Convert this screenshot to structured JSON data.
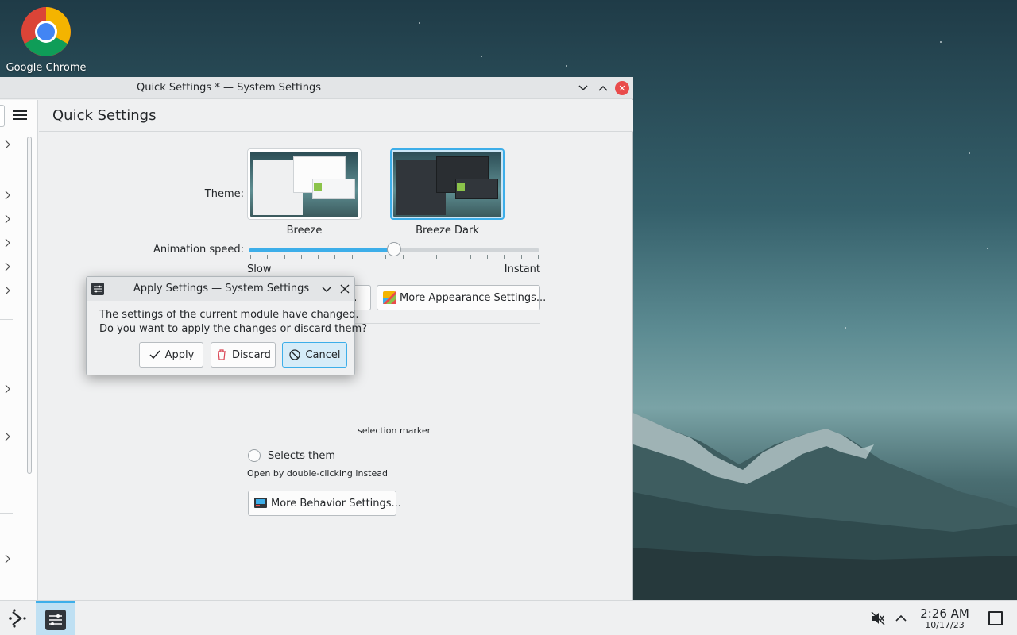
{
  "desktop": {
    "icons": [
      {
        "label": "Google Chrome"
      }
    ]
  },
  "window": {
    "title": "Quick Settings * — System Settings",
    "page_title": "Quick Settings"
  },
  "theme": {
    "label": "Theme:",
    "options": [
      {
        "name": "Breeze",
        "selected": false
      },
      {
        "name": "Breeze Dark",
        "selected": true
      }
    ]
  },
  "animation": {
    "label": "Animation speed:",
    "min_label": "Slow",
    "max_label": "Instant",
    "value_fraction": 0.5
  },
  "buttons": {
    "more_appearance": "More Appearance Settings...",
    "partial_button": "...",
    "more_behavior": "More Behavior Settings..."
  },
  "click_behavior": {
    "partial_option": "selection marker",
    "option_selects": "Selects them",
    "hint": "Open by double-clicking instead"
  },
  "dialog": {
    "title": "Apply Settings — System Settings",
    "message_line1": "The settings of the current module have changed.",
    "message_line2": "Do you want to apply the changes or discard them?",
    "apply": "Apply",
    "discard": "Discard",
    "cancel": "Cancel"
  },
  "taskbar": {
    "time": "2:26 AM",
    "date": "10/17/23"
  },
  "colors": {
    "accent": "#3daee9",
    "close": "#e94b4b",
    "window_bg": "#eff0f1"
  }
}
